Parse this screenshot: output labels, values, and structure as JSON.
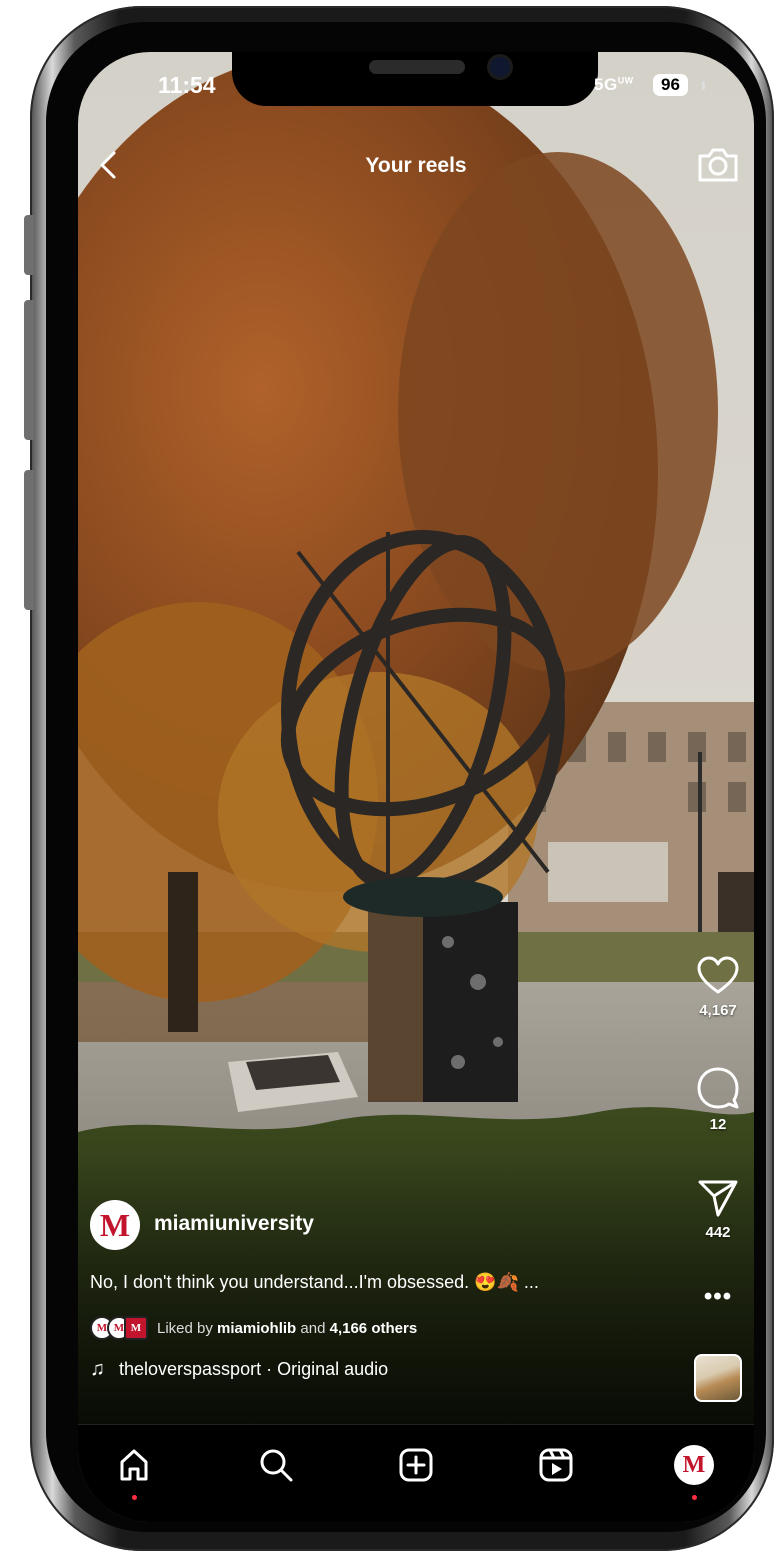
{
  "status_bar": {
    "time": "11:54",
    "network": "5G",
    "network_sup": "UW",
    "battery": "96"
  },
  "top_bar": {
    "title": "Your reels"
  },
  "actions": {
    "likes": "4,167",
    "comments": "12",
    "shares": "442"
  },
  "post": {
    "avatar_letter": "M",
    "username": "miamiuniversity",
    "caption": "No, I don't think you understand...I'm obsessed. 😍🍂 ...",
    "liked_by_prefix": "Liked by ",
    "liked_by_user": "miamiohlib",
    "liked_by_mid": " and ",
    "liked_by_count": "4,166 others",
    "audio": "theloverspassport · Original audio"
  },
  "tab_bar": {
    "profile_letter": "M"
  },
  "icons": [
    "back-icon",
    "camera-icon",
    "heart-icon",
    "comment-icon",
    "send-icon",
    "more-icon",
    "music-note-icon",
    "home-icon",
    "search-icon",
    "create-icon",
    "reels-icon"
  ]
}
